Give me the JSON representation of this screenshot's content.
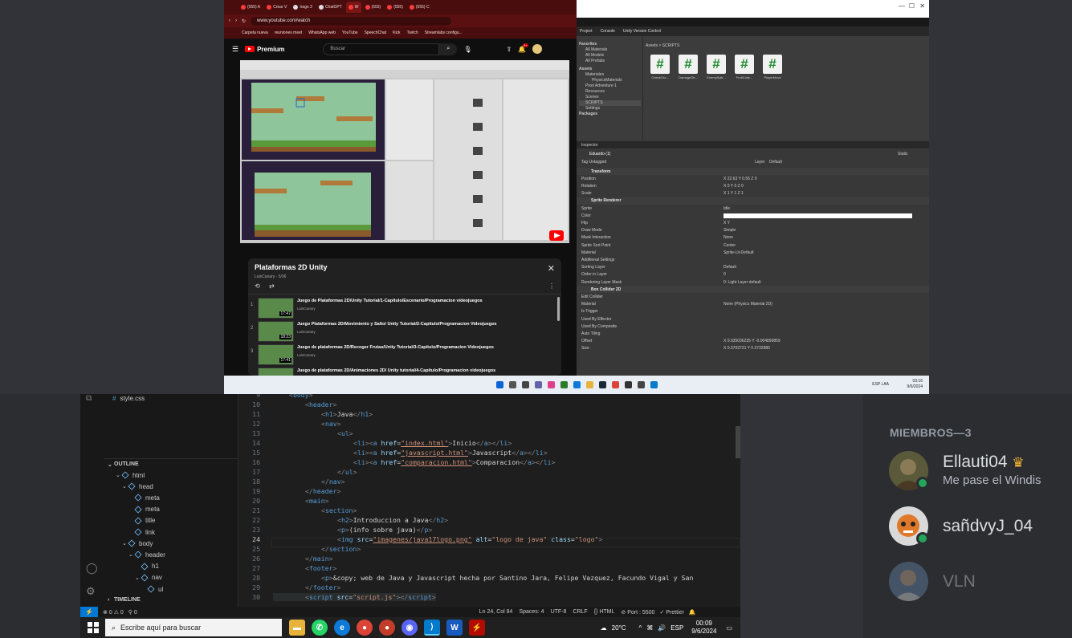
{
  "browser": {
    "tabs": [
      "(555) A",
      "Crear V",
      "Irago 2",
      "ChatGPT",
      "W",
      "(555)",
      "(555)",
      "(555) C"
    ],
    "url": "www.youtube.com/watch",
    "bookmarks": [
      "Carpeta nueva",
      "reuniones meet",
      "WhatsApp web",
      "YouTube",
      "SpeechChat",
      "Kick",
      "Twitch",
      "Streamlabs configu..."
    ]
  },
  "youtube": {
    "logo": "Premium",
    "search_placeholder": "Buscar",
    "notif_count": "9+",
    "playlist": {
      "title": "Plataformas 2D Unity",
      "subtitle": "LuisCanary - 5/36",
      "items": [
        {
          "num": "1",
          "title": "Juego de Plataformas 2D/Unity Tutorial/1-Capitulo/Escenario/Programacion videojuegos",
          "channel": "LuisCanary",
          "duration": "17:47"
        },
        {
          "num": "2",
          "title": "Juego Plataformas 2D/Movimiento y Salto/ Unity Tutorial/2-Capitulo/Programacion Videojuegos",
          "channel": "LuisCanary",
          "duration": "18:23"
        },
        {
          "num": "3",
          "title": "Juego de plataformas 2D/Recoger Frutas/Unity Tutorial/3-Capitulo/Programacion Videojuegos",
          "channel": "LuisCanary",
          "duration": "17:41"
        },
        {
          "num": "",
          "title": "Juego de plataformas 2D/Animaciones 2D/ Unity tutorial/4-Capitulo/Programacion videojuegos",
          "channel": "",
          "duration": ""
        }
      ]
    }
  },
  "unity": {
    "tabs": [
      "Project",
      "Console",
      "Unity Version Control"
    ],
    "breadcrumb": "Assets > SCRIPTS",
    "tree": [
      "Favorites",
      "All Materials",
      "All Models",
      "All Prefabs",
      "Assets",
      "Materiales",
      "PhysicsMaterials",
      "Pixel Adventure 1",
      "Resources",
      "Scenes",
      "SCRIPTS",
      "Settings",
      "Packages"
    ],
    "files": [
      "CheckGro...",
      "DamageOb...",
      "EnemySpik...",
      "FruitColle...",
      "PlayerMove"
    ],
    "inspector_tab": "Inspector",
    "object": "Eduardo (1)",
    "static": "Static",
    "tag": "Untagged",
    "layer": "Default",
    "rows": [
      {
        "k": "Transform",
        "v": "",
        "h": true
      },
      {
        "k": "Position",
        "v": "X 22.63     Y 0.55     Z 0"
      },
      {
        "k": "Rotation",
        "v": "X 0     Y 0     Z 0"
      },
      {
        "k": "Scale",
        "v": "X 1     Y 1     Z 1"
      },
      {
        "k": "Sprite Renderer",
        "v": "",
        "h": true
      },
      {
        "k": "Sprite",
        "v": "Idle"
      },
      {
        "k": "Color",
        "v": ""
      },
      {
        "k": "Flip",
        "v": "X  Y"
      },
      {
        "k": "Draw Mode",
        "v": "Simple"
      },
      {
        "k": "Mask Interaction",
        "v": "None"
      },
      {
        "k": "Sprite Sort Point",
        "v": "Center"
      },
      {
        "k": "Material",
        "v": "Sprite-Lit-Default"
      },
      {
        "k": "Additional Settings",
        "v": ""
      },
      {
        "k": "Sorting Layer",
        "v": "Default"
      },
      {
        "k": "Order in Layer",
        "v": "0"
      },
      {
        "k": "Rendering Layer Mask",
        "v": "0: Light Layer default"
      },
      {
        "k": "Box Collider 2D",
        "v": "",
        "h": true
      },
      {
        "k": "Edit Collider",
        "v": ""
      },
      {
        "k": "Material",
        "v": "None (Physics Material 2D)"
      },
      {
        "k": "Is Trigger",
        "v": ""
      },
      {
        "k": "Used By Effector",
        "v": ""
      },
      {
        "k": "Used By Composite",
        "v": ""
      },
      {
        "k": "Auto Tiling",
        "v": ""
      },
      {
        "k": "Offset",
        "v": "X 0.035036235     Y -0.004899859"
      },
      {
        "k": "Size",
        "v": "X 0.3703721     Y 0.3732885"
      }
    ]
  },
  "top_taskbar": {
    "lang": "ESP LAA",
    "time": "03:16",
    "date": "9/6/2024"
  },
  "vscode": {
    "top_file": "style.css",
    "outline_label": "OUTLINE",
    "timeline_label": "TIMELINE",
    "outline": [
      {
        "label": "html",
        "indent": 1
      },
      {
        "label": "head",
        "indent": 2
      },
      {
        "label": "meta",
        "indent": 3
      },
      {
        "label": "meta",
        "indent": 3
      },
      {
        "label": "title",
        "indent": 3
      },
      {
        "label": "link",
        "indent": 3
      },
      {
        "label": "body",
        "indent": 2
      },
      {
        "label": "header",
        "indent": 3
      },
      {
        "label": "h1",
        "indent": 4
      },
      {
        "label": "nav",
        "indent": 4
      },
      {
        "label": "ul",
        "indent": 5
      }
    ],
    "lines": [
      "9",
      "10",
      "11",
      "12",
      "13",
      "14",
      "15",
      "16",
      "17",
      "18",
      "19",
      "20",
      "21",
      "22",
      "23",
      "24",
      "25",
      "26",
      "27",
      "28",
      "29",
      "30"
    ],
    "status": {
      "errors": "0",
      "warnings": "0",
      "ports": "0",
      "position": "Ln 24, Col 84",
      "spaces": "Spaces: 4",
      "encoding": "UTF-8",
      "eol": "CRLF",
      "lang": "HTML",
      "port": "Port : 5500",
      "prettier": "Prettier"
    }
  },
  "taskbar": {
    "search_placeholder": "Escribe aquí para buscar",
    "weather": "20°C",
    "lang": "ESP",
    "time": "00:09",
    "date": "9/6/2024"
  },
  "discord": {
    "members_header": "MIEMBROS—3",
    "members": [
      {
        "name": "Ellauti04",
        "status": "Me pase el Windis",
        "online": true
      },
      {
        "name": "sañdvyJ_04",
        "status": "",
        "online": true
      },
      {
        "name": "VLN",
        "status": "",
        "online": false
      }
    ]
  }
}
